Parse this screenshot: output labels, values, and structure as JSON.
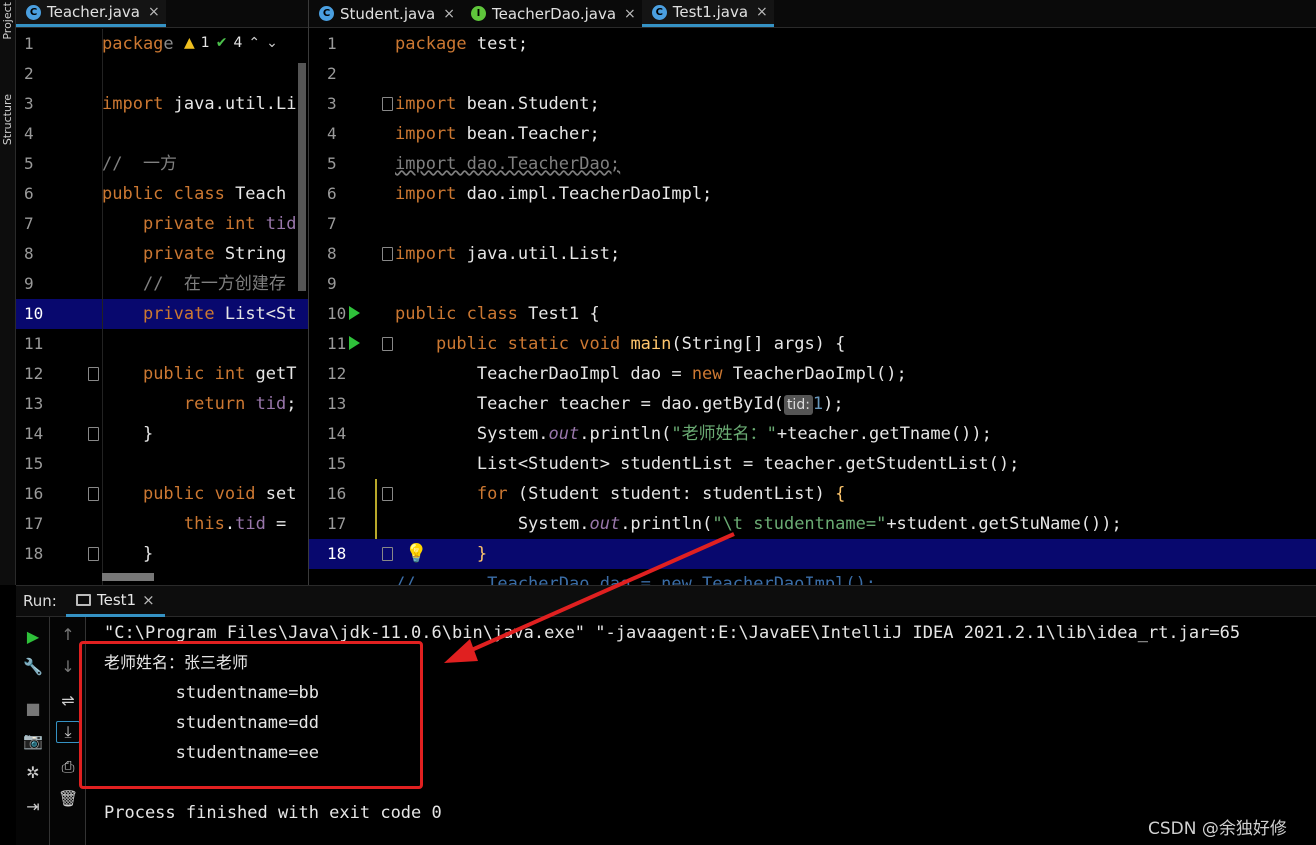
{
  "side_tabs": {
    "project": "Project",
    "structure": "Structure"
  },
  "left_editor": {
    "tab": {
      "label": "Teacher.java",
      "close": "×"
    },
    "inspections": {
      "warnings": "1",
      "checks": "4"
    },
    "highlighted_line": "10"
  },
  "right_editor": {
    "tabs": [
      {
        "label": "Student.java",
        "close": "×"
      },
      {
        "label": "TeacherDao.java",
        "close": "×"
      },
      {
        "label": "Test1.java",
        "close": "×"
      }
    ],
    "highlighted_line": "18",
    "param_hint": "tid:"
  },
  "line_numbers": [
    "1",
    "2",
    "3",
    "4",
    "5",
    "6",
    "7",
    "8",
    "9",
    "10",
    "11",
    "12",
    "13",
    "14",
    "15",
    "16",
    "17",
    "18"
  ],
  "run_panel": {
    "label": "Run:",
    "tab": "Test1",
    "tab_close": "×",
    "command": "\"C:\\Program Files\\Java\\jdk-11.0.6\\bin\\java.exe\" \"-javaagent:E:\\JavaEE\\IntelliJ IDEA 2021.2.1\\lib\\idea_rt.jar=65",
    "output": [
      "老师姓名：张三老师",
      "\tstudentname=bb",
      "\tstudentname=dd",
      "\tstudentname=ee"
    ],
    "exit": "Process finished with exit code 0"
  },
  "watermark": "CSDN @余独好修",
  "colors": {
    "highlight": "#08086e",
    "annotation": "#e02020",
    "tab_underline": "#3592c4"
  }
}
